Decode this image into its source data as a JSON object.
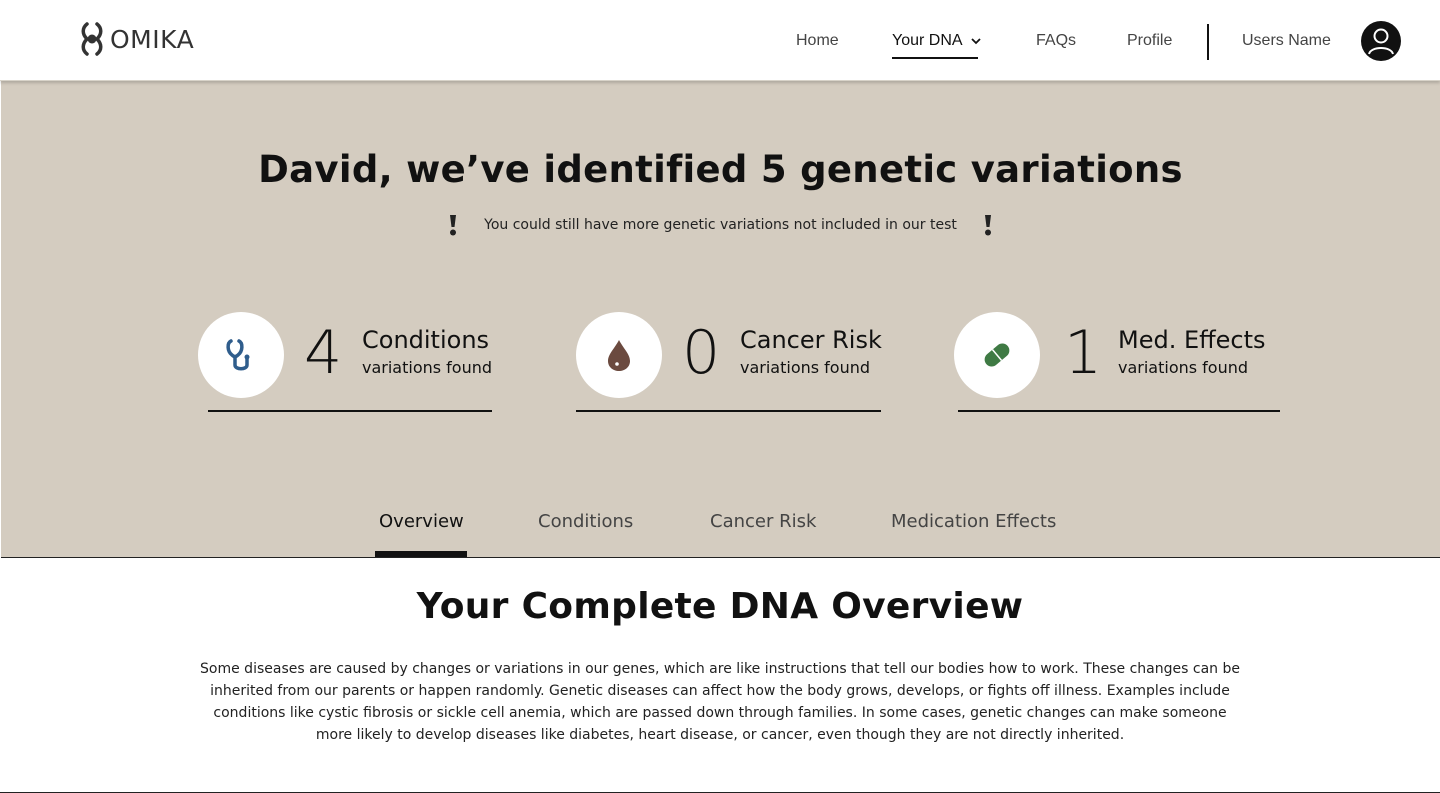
{
  "brand": {
    "name": "OMIKA"
  },
  "nav": {
    "home": "Home",
    "your_dna": "Your DNA",
    "faqs": "FAQs",
    "profile": "Profile",
    "user_name": "Users Name"
  },
  "hero": {
    "headline_prefix": "David, we’ve identified ",
    "headline_count": "5",
    "headline_suffix": " genetic variations",
    "notice": "You could still have more genetic variations not included in our test"
  },
  "stats": [
    {
      "count": "4",
      "title": "Conditions",
      "subtitle": "variations found",
      "icon": "stethoscope-icon",
      "color": "#2f5d8c"
    },
    {
      "count": "0",
      "title": "Cancer Risk",
      "subtitle": "variations found",
      "icon": "blood-drop-icon",
      "color": "#6b4a3f"
    },
    {
      "count": "1",
      "title": "Med. Effects",
      "subtitle": "variations found",
      "icon": "pill-icon",
      "color": "#3f7a44"
    }
  ],
  "tabs": [
    {
      "label": "Overview",
      "active": true
    },
    {
      "label": "Conditions",
      "active": false
    },
    {
      "label": "Cancer Risk",
      "active": false
    },
    {
      "label": "Medication Effects",
      "active": false
    }
  ],
  "overview": {
    "title_prefix": "Your ",
    "title_bold": "Complete",
    "title_suffix": " DNA Overview",
    "body": "Some diseases are caused by changes or variations in our genes, which are like instructions that tell our bodies how to work. These changes can be inherited from our parents or happen randomly. Genetic diseases can affect how the body grows, develops, or fights off illness. Examples include conditions like cystic fibrosis or sickle cell anemia, which are passed down through families. In some cases, genetic changes can make someone more likely to develop diseases like diabetes, heart disease, or cancer, even though they are not directly inherited."
  },
  "colors": {
    "hero_bg": "#d4ccc0",
    "text": "#111111"
  }
}
